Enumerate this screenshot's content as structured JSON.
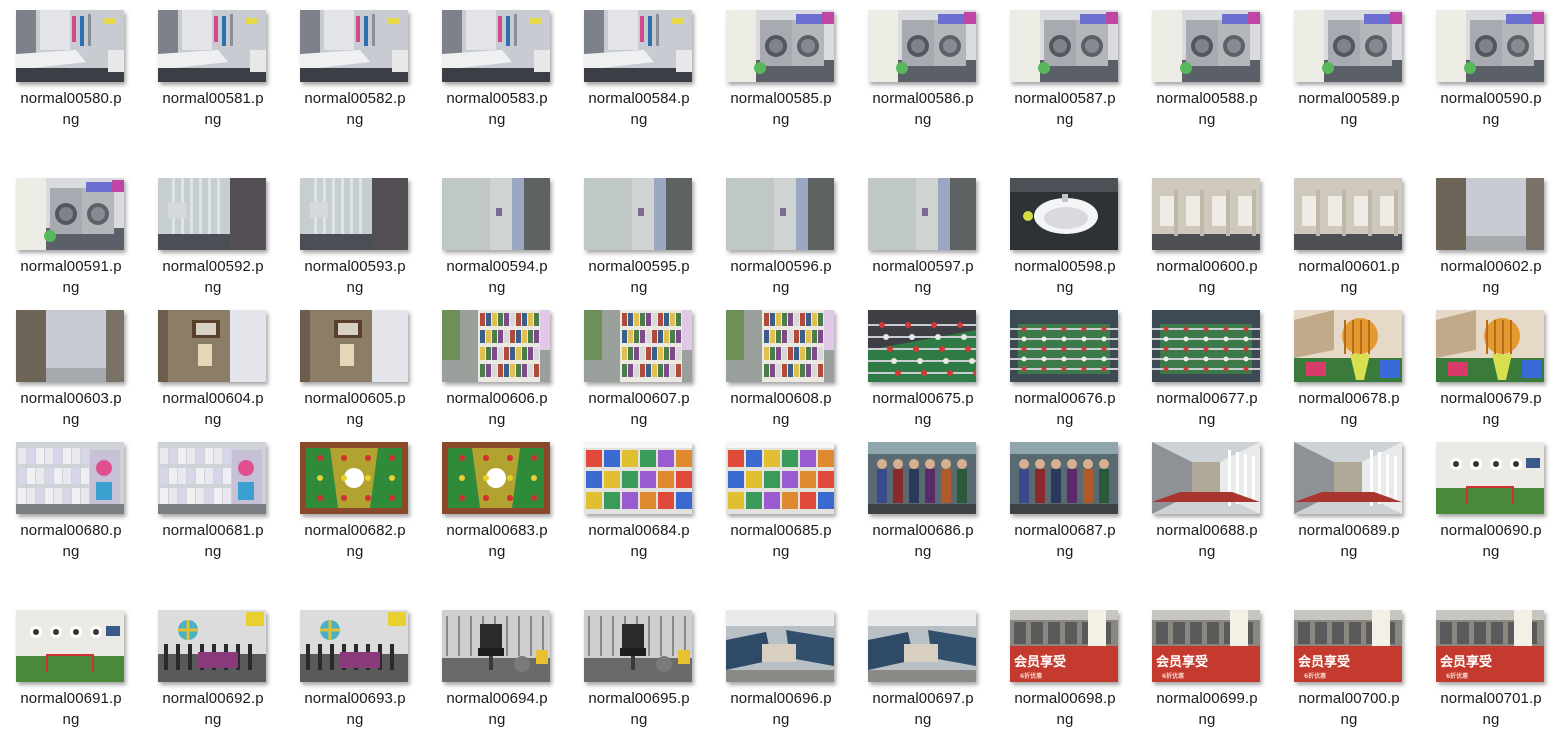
{
  "files": [
    {
      "name_line1": "normal00580.p",
      "name_line2": "ng",
      "scene": "bathroom-sink"
    },
    {
      "name_line1": "normal00581.p",
      "name_line2": "ng",
      "scene": "bathroom-sink"
    },
    {
      "name_line1": "normal00582.p",
      "name_line2": "ng",
      "scene": "bathroom-sink"
    },
    {
      "name_line1": "normal00583.p",
      "name_line2": "ng",
      "scene": "bathroom-sink"
    },
    {
      "name_line1": "normal00584.p",
      "name_line2": "ng",
      "scene": "bathroom-sink"
    },
    {
      "name_line1": "normal00585.p",
      "name_line2": "ng",
      "scene": "washing-machines"
    },
    {
      "name_line1": "normal00586.p",
      "name_line2": "ng",
      "scene": "washing-machines"
    },
    {
      "name_line1": "normal00587.p",
      "name_line2": "ng",
      "scene": "washing-machines"
    },
    {
      "name_line1": "normal00588.p",
      "name_line2": "ng",
      "scene": "washing-machines"
    },
    {
      "name_line1": "normal00589.p",
      "name_line2": "ng",
      "scene": "washing-machines"
    },
    {
      "name_line1": "normal00590.p",
      "name_line2": "ng",
      "scene": "washing-machines"
    },
    {
      "name_line1": "normal00591.p",
      "name_line2": "ng",
      "scene": "washing-machines"
    },
    {
      "name_line1": "normal00592.p",
      "name_line2": "ng",
      "scene": "shower-curtain"
    },
    {
      "name_line1": "normal00593.p",
      "name_line2": "ng",
      "scene": "shower-curtain"
    },
    {
      "name_line1": "normal00594.p",
      "name_line2": "ng",
      "scene": "shower-glass"
    },
    {
      "name_line1": "normal00595.p",
      "name_line2": "ng",
      "scene": "shower-glass"
    },
    {
      "name_line1": "normal00596.p",
      "name_line2": "ng",
      "scene": "shower-glass"
    },
    {
      "name_line1": "normal00597.p",
      "name_line2": "ng",
      "scene": "shower-glass"
    },
    {
      "name_line1": "normal00598.p",
      "name_line2": "ng",
      "scene": "basin"
    },
    {
      "name_line1": "normal00600.p",
      "name_line2": "ng",
      "scene": "urinals"
    },
    {
      "name_line1": "normal00601.p",
      "name_line2": "ng",
      "scene": "urinals"
    },
    {
      "name_line1": "normal00602.p",
      "name_line2": "ng",
      "scene": "doorway"
    },
    {
      "name_line1": "normal00603.p",
      "name_line2": "ng",
      "scene": "doorway"
    },
    {
      "name_line1": "normal00604.p",
      "name_line2": "ng",
      "scene": "door-sign"
    },
    {
      "name_line1": "normal00605.p",
      "name_line2": "ng",
      "scene": "door-sign"
    },
    {
      "name_line1": "normal00606.p",
      "name_line2": "ng",
      "scene": "bookshelf"
    },
    {
      "name_line1": "normal00607.p",
      "name_line2": "ng",
      "scene": "bookshelf"
    },
    {
      "name_line1": "normal00608.p",
      "name_line2": "ng",
      "scene": "bookshelf"
    },
    {
      "name_line1": "normal00675.p",
      "name_line2": "ng",
      "scene": "foosball"
    },
    {
      "name_line1": "normal00676.p",
      "name_line2": "ng",
      "scene": "foosball-dark"
    },
    {
      "name_line1": "normal00677.p",
      "name_line2": "ng",
      "scene": "foosball-dark"
    },
    {
      "name_line1": "normal00678.p",
      "name_line2": "ng",
      "scene": "lantern-box"
    },
    {
      "name_line1": "normal00679.p",
      "name_line2": "ng",
      "scene": "lantern-box"
    },
    {
      "name_line1": "normal00680.p",
      "name_line2": "ng",
      "scene": "shelves-colorful"
    },
    {
      "name_line1": "normal00681.p",
      "name_line2": "ng",
      "scene": "shelves-colorful"
    },
    {
      "name_line1": "normal00682.p",
      "name_line2": "ng",
      "scene": "foosball-board"
    },
    {
      "name_line1": "normal00683.p",
      "name_line2": "ng",
      "scene": "foosball-board"
    },
    {
      "name_line1": "normal00684.p",
      "name_line2": "ng",
      "scene": "shelves-games"
    },
    {
      "name_line1": "normal00685.p",
      "name_line2": "ng",
      "scene": "shelves-games"
    },
    {
      "name_line1": "normal00686.p",
      "name_line2": "ng",
      "scene": "figures"
    },
    {
      "name_line1": "normal00687.p",
      "name_line2": "ng",
      "scene": "figures"
    },
    {
      "name_line1": "normal00688.p",
      "name_line2": "ng",
      "scene": "corridor"
    },
    {
      "name_line1": "normal00689.p",
      "name_line2": "ng",
      "scene": "corridor"
    },
    {
      "name_line1": "normal00690.p",
      "name_line2": "ng",
      "scene": "turf-room"
    },
    {
      "name_line1": "normal00691.p",
      "name_line2": "ng",
      "scene": "turf-room"
    },
    {
      "name_line1": "normal00692.p",
      "name_line2": "ng",
      "scene": "gym-rack"
    },
    {
      "name_line1": "normal00693.p",
      "name_line2": "ng",
      "scene": "gym-rack"
    },
    {
      "name_line1": "normal00694.p",
      "name_line2": "ng",
      "scene": "gym-chair"
    },
    {
      "name_line1": "normal00695.p",
      "name_line2": "ng",
      "scene": "gym-chair"
    },
    {
      "name_line1": "normal00696.p",
      "name_line2": "ng",
      "scene": "lounge"
    },
    {
      "name_line1": "normal00697.p",
      "name_line2": "ng",
      "scene": "lounge"
    },
    {
      "name_line1": "normal00698.p",
      "name_line2": "ng",
      "scene": "shop-sign"
    },
    {
      "name_line1": "normal00699.p",
      "name_line2": "ng",
      "scene": "shop-sign"
    },
    {
      "name_line1": "normal00700.p",
      "name_line2": "ng",
      "scene": "shop-sign"
    },
    {
      "name_line1": "normal00701.p",
      "name_line2": "ng",
      "scene": "shop-sign"
    }
  ],
  "sign_text": "会员享受",
  "sign_subtext": "6折优惠"
}
